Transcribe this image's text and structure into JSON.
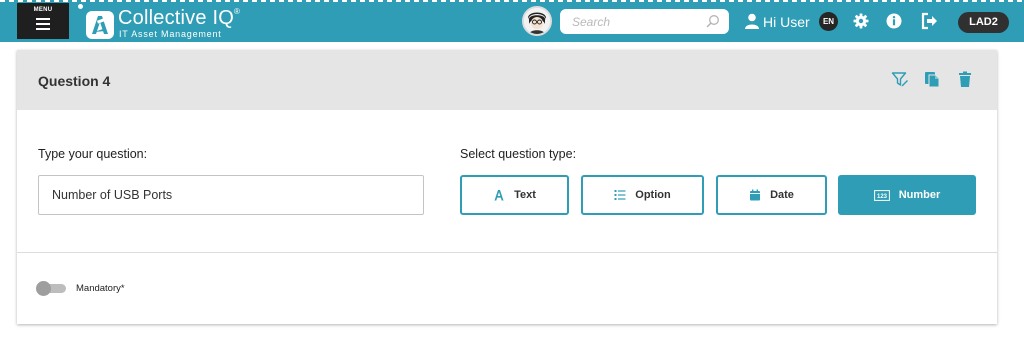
{
  "app": {
    "menu_label": "MENU",
    "brand_name": "Collective IQ",
    "brand_mark": "®",
    "brand_subtitle": "IT Asset Management"
  },
  "search": {
    "placeholder": "Search",
    "value": ""
  },
  "user": {
    "greeting": "Hi User",
    "language": "EN",
    "site": "LAD2"
  },
  "question": {
    "title": "Question 4",
    "prompt_label": "Type your question:",
    "value": "Number of USB Ports",
    "type_label": "Select question type:",
    "types": [
      {
        "label": "Text",
        "icon": "text-a-icon",
        "selected": false
      },
      {
        "label": "Option",
        "icon": "list-icon",
        "selected": false
      },
      {
        "label": "Date",
        "icon": "calendar-icon",
        "selected": false
      },
      {
        "label": "Number",
        "icon": "number-123-icon",
        "selected": true
      }
    ],
    "mandatory_label": "Mandatory*",
    "mandatory": false
  },
  "colors": {
    "accent": "#2e9db5",
    "header_bar": "#2e9db5",
    "card_header": "#e5e5e5",
    "dark_pill": "#303030"
  }
}
